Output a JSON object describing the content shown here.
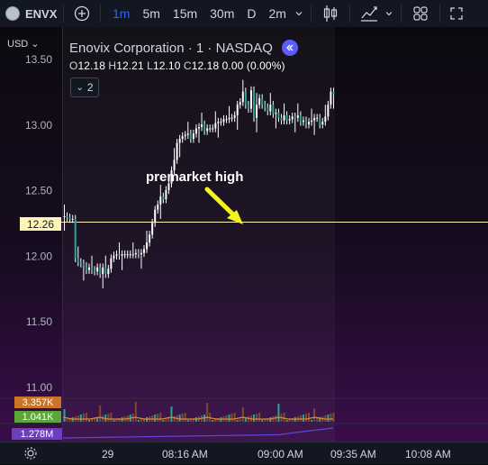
{
  "toolbar": {
    "symbol": "ENVX",
    "intervals": [
      "1m",
      "5m",
      "15m",
      "30m",
      "D",
      "2m"
    ],
    "active_interval": "1m",
    "icons": [
      "plus-circle-icon",
      "candles-icon",
      "indicators-icon",
      "layout-grid-icon",
      "fullscreen-icon"
    ]
  },
  "legend": {
    "title": "Enovix Corporation · 1 · NASDAQ",
    "ohlc": {
      "o": "12.18",
      "h": "12.21",
      "l": "12.10",
      "c": "12.18",
      "chg": "0.00 (0.00%)"
    },
    "indicator_count": "2"
  },
  "currency": "USD",
  "annotation": "premarket high",
  "price_tag": "12.26",
  "volume_tags": {
    "v1": "3.357K",
    "v2": "1.041K",
    "v3": "1.278M"
  },
  "colors": {
    "accent": "#2962ff",
    "price_line": "#fff4b8",
    "up": "#26a69a",
    "down": "#ef5350",
    "arrow": "#f5f51e"
  },
  "chart_data": {
    "type": "candlestick",
    "y_ticks": [
      "13.50",
      "13.00",
      "12.50",
      "12.00",
      "11.50",
      "11.00"
    ],
    "ylim": [
      11.0,
      13.5
    ],
    "x_ticks": [
      "29",
      "08:16 AM",
      "09:00 AM",
      "09:35 AM",
      "10:08 AM"
    ],
    "price_line": 12.26,
    "close": [
      12.25,
      12.24,
      12.23,
      12.23,
      11.93,
      11.9,
      11.89,
      11.87,
      11.84,
      11.86,
      11.84,
      11.83,
      11.86,
      11.81,
      11.86,
      11.81,
      11.85,
      11.93,
      11.95,
      11.96,
      11.95,
      11.96,
      11.96,
      11.96,
      11.96,
      11.96,
      11.97,
      11.96,
      11.97,
      12.0,
      12.05,
      12.11,
      12.2,
      12.3,
      12.34,
      12.4,
      12.38,
      12.45,
      12.5,
      12.6,
      12.68,
      12.81,
      12.84,
      12.86,
      12.87,
      12.88,
      12.84,
      12.88,
      12.92,
      12.93,
      12.95,
      12.9,
      12.92,
      12.92,
      12.92,
      12.96,
      12.97,
      12.97,
      12.99,
      12.99,
      13.0,
      13.0,
      13.02,
      13.1,
      13.12,
      13.2,
      13.1,
      13.07,
      13.21,
      13.0,
      13.1,
      13.15,
      13.1,
      13.08,
      13.05,
      13.1,
      13.03,
      13.04,
      13.0,
      12.98,
      13.02,
      12.98,
      12.99,
      13.01,
      13.0,
      13.02,
      12.97,
      12.98,
      12.95,
      12.97,
      12.98,
      13.0,
      13.0,
      12.95,
      12.97,
      13.01,
      13.1,
      13.2,
      13.18
    ]
  }
}
